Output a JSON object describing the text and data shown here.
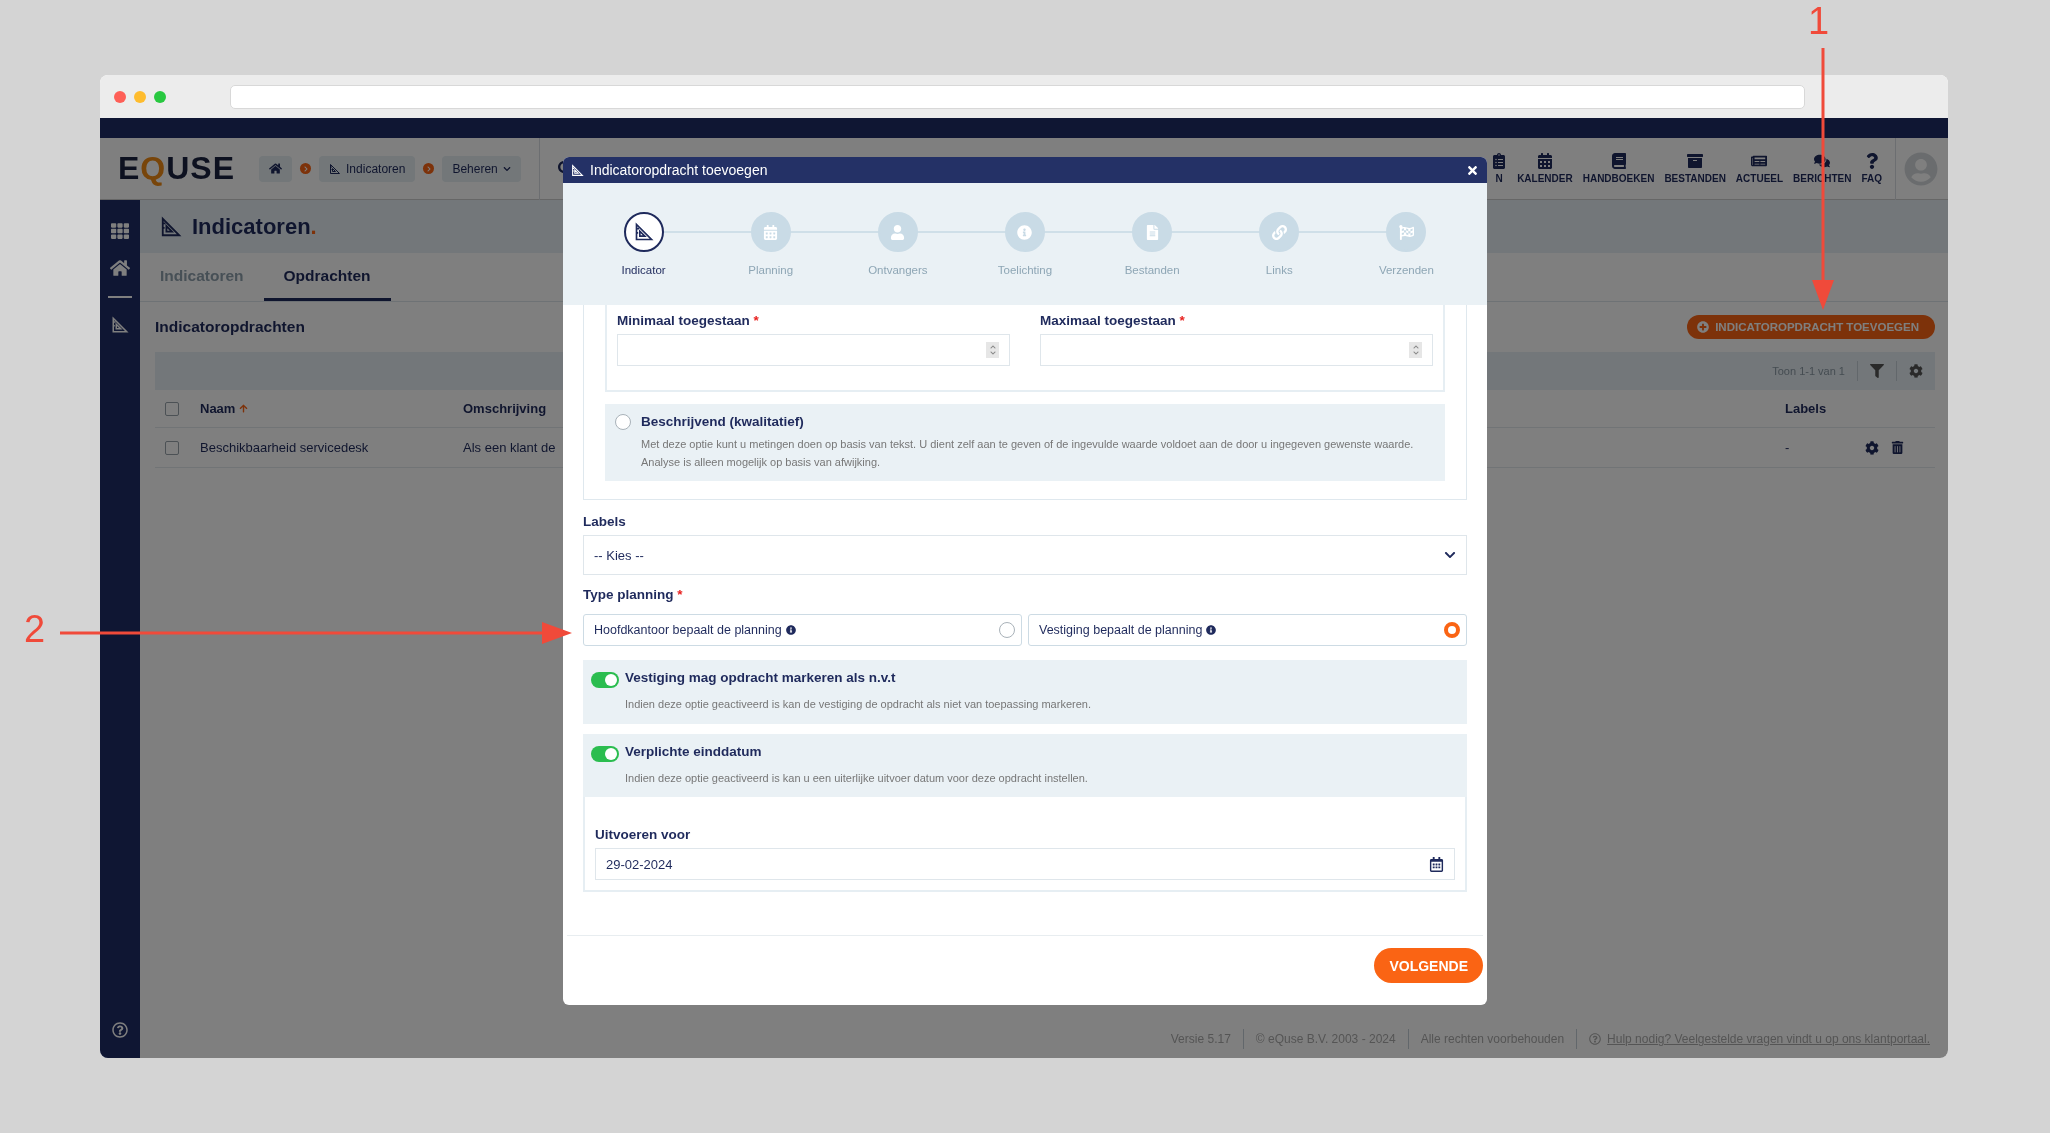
{
  "annotations": [
    {
      "label": "1",
      "kind": "down"
    },
    {
      "label": "2",
      "kind": "right"
    }
  ],
  "app": {
    "logo": [
      "E",
      "Q",
      "USE"
    ],
    "breadcrumbs": [
      {
        "kind": "home"
      },
      {
        "kind": "link",
        "label": "Indicatoren"
      },
      {
        "kind": "menu",
        "label": "Beheren"
      }
    ],
    "nav": [
      {
        "label": "N",
        "kind": "tasks"
      },
      {
        "label": "KALENDER",
        "kind": "calendar"
      },
      {
        "label": "HANDBOEKEN",
        "kind": "book"
      },
      {
        "label": "BESTANDEN",
        "kind": "archive"
      },
      {
        "label": "ACTUEEL",
        "kind": "news"
      },
      {
        "label": "BERICHTEN",
        "kind": "chat"
      },
      {
        "label": "FAQ",
        "kind": "faq"
      }
    ],
    "page_title": "Indicatoren",
    "title_dot": ".",
    "tabs": [
      {
        "label": "Indicatoren",
        "selected": false
      },
      {
        "label": "Opdrachten",
        "selected": true
      }
    ],
    "section_title": "Indicatoropdrachten",
    "add_button": "INDICATOROPDRACHT TOEVOEGEN",
    "pager": "Toon 1-1 van 1",
    "table": {
      "select_all_checked": false,
      "columns": [
        {
          "label": "Naam",
          "sorted": true
        },
        {
          "label": "Omschrijving",
          "sorted": false
        },
        {
          "label": "Labels",
          "sorted": false
        }
      ],
      "rows": [
        {
          "checked": false,
          "cells": [
            "Beschikbaarheid servicedesk",
            "Als een klant de",
            "-"
          ]
        }
      ]
    },
    "footer": {
      "items": [
        "Versie 5.17",
        "© eQuse B.V. 2003 - 2024",
        "Alle rechten voorbehouden"
      ],
      "help_link": "Hulp nodig? Veelgestelde vragen vindt u op ons klantportaal."
    }
  },
  "modal": {
    "title": "Indicatoropdracht toevoegen",
    "required_mark": "*",
    "steps": [
      {
        "label": "Indicator",
        "kind": "indicator",
        "selected": true
      },
      {
        "label": "Planning",
        "kind": "calendar",
        "selected": false
      },
      {
        "label": "Ontvangers",
        "kind": "user",
        "selected": false
      },
      {
        "label": "Toelichting",
        "kind": "info",
        "selected": false
      },
      {
        "label": "Bestanden",
        "kind": "file",
        "selected": false
      },
      {
        "label": "Links",
        "kind": "link",
        "selected": false
      },
      {
        "label": "Verzenden",
        "kind": "flag",
        "selected": false
      }
    ],
    "range_fields": [
      {
        "label": "Minimaal toegestaan",
        "required": true
      },
      {
        "label": "Maximaal toegestaan",
        "required": true
      }
    ],
    "descriptive_option": {
      "label": "Beschrijvend (kwalitatief)",
      "selected": false,
      "description": "Met deze optie kunt u metingen doen op basis van tekst. U dient zelf aan te geven of de ingevulde waarde voldoet aan de door u ingegeven gewenste waarde. Analyse is alleen mogelijk op basis van afwijking."
    },
    "labels_field": {
      "label": "Labels",
      "value": "-- Kies --"
    },
    "type_planning": {
      "label": "Type planning",
      "required": true,
      "options": [
        {
          "label": "Hoofdkantoor bepaalt de planning",
          "selected": false
        },
        {
          "label": "Vestiging bepaalt de planning",
          "selected": true
        }
      ]
    },
    "toggles": [
      {
        "label": "Vestiging mag opdracht markeren als n.v.t",
        "description": "Indien deze optie geactiveerd is kan de vestiging de opdracht als niet van toepassing markeren.",
        "on": true
      },
      {
        "label": "Verplichte einddatum",
        "description": "Indien deze optie geactiveerd is kan u een uiterlijke uitvoer datum voor deze opdracht instellen.",
        "on": true
      }
    ],
    "due_date": {
      "label": "Uitvoeren voor",
      "value": "29-02-2024"
    },
    "next_button": "VOLGENDE"
  }
}
